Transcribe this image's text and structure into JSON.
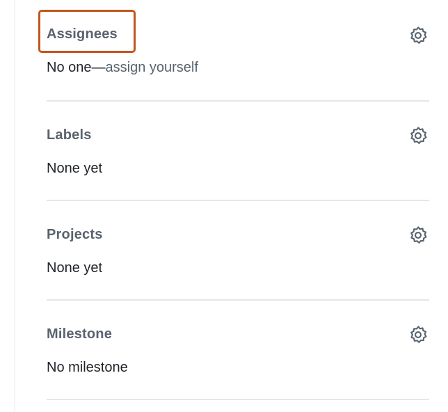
{
  "sidebar": {
    "assignees": {
      "heading": "Assignees",
      "value_prefix": "No one—",
      "value_link": "assign yourself"
    },
    "labels": {
      "heading": "Labels",
      "value": "None yet"
    },
    "projects": {
      "heading": "Projects",
      "value": "None yet"
    },
    "milestone": {
      "heading": "Milestone",
      "value": "No milestone"
    }
  },
  "icons": {
    "settings": "gear-icon"
  },
  "colors": {
    "highlight": "#c1561b",
    "heading": "#59636e",
    "text": "#1f2328",
    "divider": "#e3e6ea"
  }
}
